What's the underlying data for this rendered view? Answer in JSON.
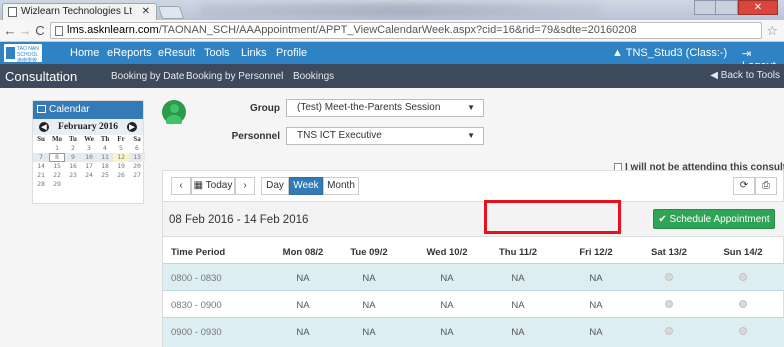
{
  "browser": {
    "tab_title": "Wizlearn Technologies Lt",
    "url_prefix": "lms.asknlearn.com",
    "url_rest": "/TAONAN_SCH/AAAppointment/APPT_ViewCalendarWeek.aspx?cid=16&rid=79&sdte=20160208"
  },
  "topnav": {
    "items": [
      "Home",
      "eReports",
      "eResult",
      "Tools",
      "Links",
      "Profile"
    ],
    "user": "TNS_Stud3 (Class:-)",
    "logout": "Logout",
    "brand_color": "#2e83c5"
  },
  "subnav": {
    "title": "Consultation",
    "items": [
      "Booking by Date",
      "Booking by Personnel",
      "Bookings"
    ],
    "back": "Back to Tools"
  },
  "calendar": {
    "title": "Calendar",
    "month": "February 2016",
    "day_headers": [
      "Su",
      "Mo",
      "Tu",
      "We",
      "Th",
      "Fr",
      "Sa"
    ],
    "weeks": [
      [
        "",
        "1",
        "2",
        "3",
        "4",
        "5",
        "6"
      ],
      [
        "7",
        "8",
        "9",
        "10",
        "11",
        "12",
        "13"
      ],
      [
        "14",
        "15",
        "16",
        "17",
        "18",
        "19",
        "20"
      ],
      [
        "21",
        "22",
        "23",
        "24",
        "25",
        "26",
        "27"
      ],
      [
        "28",
        "29",
        "",
        "",
        "",
        "",
        ""
      ]
    ],
    "selected_day": "8",
    "highlight_day": "12"
  },
  "form": {
    "group_label": "Group",
    "group_value": "(Test) Meet-the-Parents Session",
    "personnel_label": "Personnel",
    "personnel_value": "TNS ICT Executive",
    "not_attending": "I will not be attending this consultation."
  },
  "toolbar": {
    "prev": "‹",
    "today": "Today",
    "next": "›",
    "views": [
      "Day",
      "Week",
      "Month"
    ],
    "active_view": "Week",
    "refresh": "⟳",
    "print": "⎙"
  },
  "week": {
    "range": "08 Feb 2016 - 14 Feb 2016",
    "schedule_button": "Schedule Appointment"
  },
  "table": {
    "headers": [
      "Time Period",
      "Mon 08/2",
      "Tue 09/2",
      "Wed 10/2",
      "Thu 11/2",
      "Fri 12/2",
      "Sat 13/2",
      "Sun 14/2"
    ],
    "rows": [
      {
        "time": "0800 - 0830",
        "cells": [
          "NA",
          "NA",
          "NA",
          "NA",
          "NA"
        ]
      },
      {
        "time": "0830 - 0900",
        "cells": [
          "NA",
          "NA",
          "NA",
          "NA",
          "NA"
        ]
      },
      {
        "time": "0900 - 0930",
        "cells": [
          "NA",
          "NA",
          "NA",
          "NA",
          "NA"
        ]
      }
    ]
  }
}
